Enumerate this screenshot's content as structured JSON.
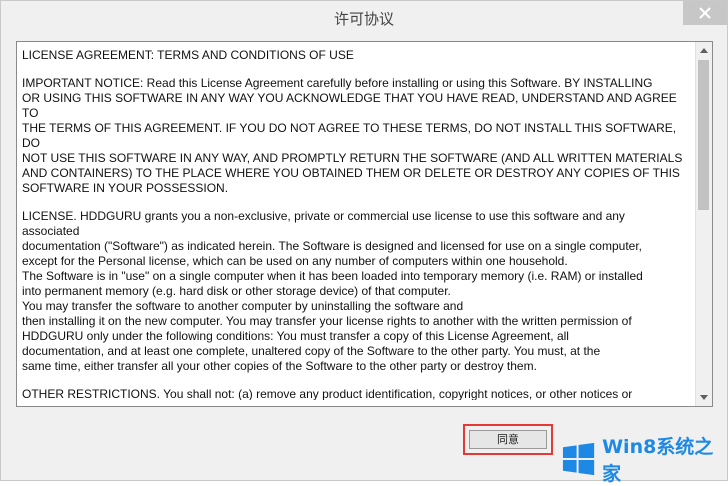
{
  "window": {
    "title": "许可协议"
  },
  "license": {
    "paragraphs": [
      "LICENSE AGREEMENT: TERMS AND CONDITIONS OF USE",
      "IMPORTANT NOTICE: Read this License Agreement carefully before installing or using this Software. BY INSTALLING\nOR USING THIS SOFTWARE IN ANY WAY YOU ACKNOWLEDGE THAT YOU HAVE READ, UNDERSTAND AND AGREE TO\nTHE TERMS OF THIS AGREEMENT. IF YOU DO NOT AGREE TO THESE TERMS, DO NOT INSTALL THIS SOFTWARE, DO\nNOT USE THIS SOFTWARE IN ANY WAY, AND PROMPTLY RETURN THE SOFTWARE (AND ALL WRITTEN MATERIALS\nAND CONTAINERS) TO THE PLACE WHERE YOU OBTAINED THEM OR DELETE OR DESTROY ANY COPIES OF THIS\nSOFTWARE IN YOUR POSSESSION.",
      "LICENSE. HDDGURU grants you a non-exclusive, private or commercial use license to use this software and any\nassociated\ndocumentation (\"Software\") as indicated herein.  The Software is designed and licensed for use on a single computer,\nexcept for the Personal license, which can be used on any number of computers within one household.\nThe Software is in \"use\" on a single computer when it has been loaded into temporary memory (i.e. RAM) or installed\ninto permanent memory (e.g. hard disk or other storage device) of that computer.\nYou may transfer the software to another computer by uninstalling the software and\nthen installing it on the new computer. You may transfer your license rights to another with the written permission of\nHDDGURU only under the following conditions: You must transfer a copy of this License Agreement, all\ndocumentation, and at least one complete, unaltered copy of the Software to the other party.  You must, at the\nsame time, either transfer all your other copies of the Software to the other party or destroy them.",
      "OTHER RESTRICTIONS. You shall not: (a) remove any product identification, copyright notices, or other notices or\nproprietary restrictions from the Software; (b) transfer, rent, lease, sublicense, copy, or distribute the Software"
    ]
  },
  "buttons": {
    "agree_label": "同意"
  },
  "watermark": {
    "text": "Win8系统之家"
  },
  "colors": {
    "highlight": "#e53935",
    "watermark": "#1e88e5"
  }
}
